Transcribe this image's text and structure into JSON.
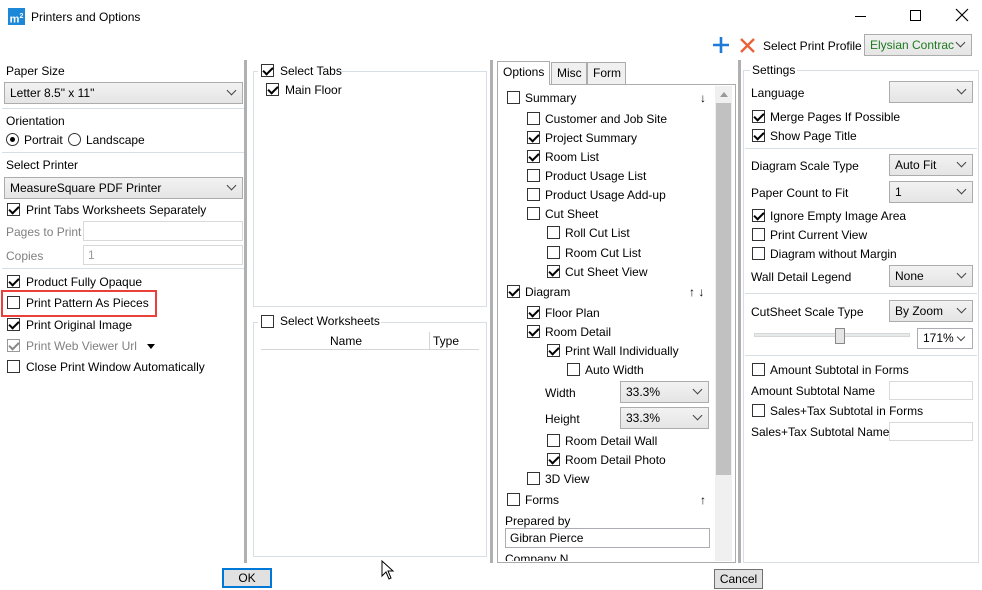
{
  "window": {
    "title": "Printers and Options",
    "app_icon": "m²-icon"
  },
  "toolbar": {
    "profile_label": "Select Print Profile",
    "profile_value": "Elysian Contrac",
    "add_icon": "plus-icon",
    "remove_icon": "close-x-icon"
  },
  "left": {
    "paper_size_label": "Paper Size",
    "paper_size_value": "Letter 8.5\" x 11\"",
    "orientation_label": "Orientation",
    "portrait": "Portrait",
    "landscape": "Landscape",
    "select_printer_label": "Select Printer",
    "printer_value": "MeasureSquare PDF Printer",
    "print_tabs_separately": "Print Tabs Worksheets Separately",
    "pages_to_print_label": "Pages to Print",
    "copies_label": "Copies",
    "copies_value": "1",
    "product_fully_opaque": "Product Fully Opaque",
    "print_pattern_as_pieces": "Print Pattern As Pieces",
    "print_original_image": "Print Original Image",
    "print_web_viewer_url": "Print Web Viewer Url",
    "close_print_window": "Close Print Window Automatically"
  },
  "tabs_panel": {
    "select_tabs": "Select Tabs",
    "main_floor": "Main Floor",
    "select_worksheets": "Select Worksheets",
    "col_name": "Name",
    "col_type": "Type"
  },
  "options": {
    "tabs": [
      "Options",
      "Misc",
      "Form"
    ],
    "summary": "Summary",
    "customer_job_site": "Customer and Job Site",
    "project_summary": "Project Summary",
    "room_list": "Room List",
    "product_usage_list": "Product Usage List",
    "product_usage_addup": "Product Usage Add-up",
    "cut_sheet": "Cut Sheet",
    "roll_cut_list": "Roll Cut List",
    "room_cut_list": "Room Cut List",
    "cut_sheet_view": "Cut Sheet View",
    "diagram": "Diagram",
    "floor_plan": "Floor Plan",
    "room_detail": "Room Detail",
    "print_wall_individually": "Print Wall Individually",
    "auto_width": "Auto Width",
    "width_label": "Width",
    "width_value": "33.3%",
    "height_label": "Height",
    "height_value": "33.3%",
    "room_detail_wall": "Room Detail Wall",
    "room_detail_photo": "Room Detail Photo",
    "view_3d": "3D View",
    "forms": "Forms",
    "prepared_by_label": "Prepared by",
    "prepared_by_value": "Gibran Pierce",
    "company_cut": "Company N",
    "down_arrow": "↓",
    "up_down_arrows": "↑ ↓",
    "up_arrow": "↑"
  },
  "settings": {
    "title": "Settings",
    "language_label": "Language",
    "language_value": "",
    "merge_pages": "Merge Pages If Possible",
    "show_page_title": "Show Page Title",
    "diagram_scale_type_label": "Diagram Scale Type",
    "diagram_scale_type_value": "Auto Fit",
    "paper_count_label": "Paper Count to Fit",
    "paper_count_value": "1",
    "ignore_empty_image": "Ignore Empty Image Area",
    "print_current_view": "Print Current View",
    "diagram_without_margin": "Diagram without Margin",
    "wall_detail_legend_label": "Wall Detail Legend",
    "wall_detail_legend_value": "None",
    "cutsheet_scale_type_label": "CutSheet Scale Type",
    "cutsheet_scale_type_value": "By Zoom",
    "zoom_value": "171%",
    "zoom_fraction": 0.45,
    "amount_subtotal_in_forms": "Amount Subtotal in Forms",
    "amount_subtotal_name_label": "Amount Subtotal Name",
    "sales_tax_subtotal_in_forms": "Sales+Tax Subtotal in Forms",
    "sales_tax_subtotal_name_label": "Sales+Tax Subtotal Name"
  },
  "footer": {
    "ok": "OK",
    "cancel": "Cancel"
  },
  "colors": {
    "accent": "#0078d7",
    "highlight": "#e8413b",
    "profile_text": "#1e7a1e",
    "remove": "#e8623a"
  }
}
